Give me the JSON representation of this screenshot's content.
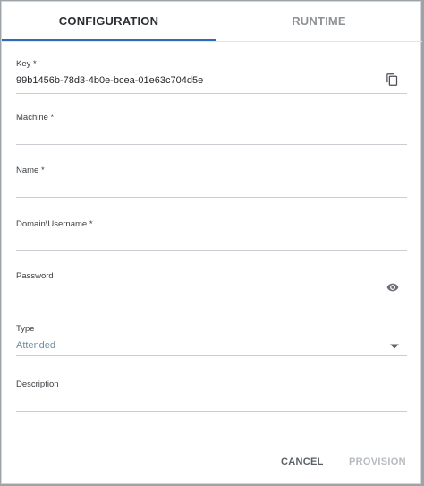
{
  "tabs": {
    "configuration": "CONFIGURATION",
    "runtime": "RUNTIME"
  },
  "fields": {
    "key": {
      "label": "Key *",
      "value": "99b1456b-78d3-4b0e-bcea-01e63c704d5e"
    },
    "machine": {
      "label": "Machine *",
      "value": ""
    },
    "name": {
      "label": "Name *",
      "value": ""
    },
    "domain_username": {
      "label": "Domain\\Username *",
      "value": ""
    },
    "password": {
      "label": "Password",
      "value": ""
    },
    "type": {
      "label": "Type",
      "value": "Attended"
    },
    "description": {
      "label": "Description",
      "value": ""
    }
  },
  "icons": {
    "copy": "copy-icon",
    "visibility": "eye-icon",
    "dropdown": "chevron-down-icon"
  },
  "actions": {
    "cancel": "CANCEL",
    "provision": "PROVISION"
  },
  "colors": {
    "accent": "#2e6bb8",
    "select_text": "#6e8fa0",
    "disabled_button": "#b7bbbf"
  }
}
